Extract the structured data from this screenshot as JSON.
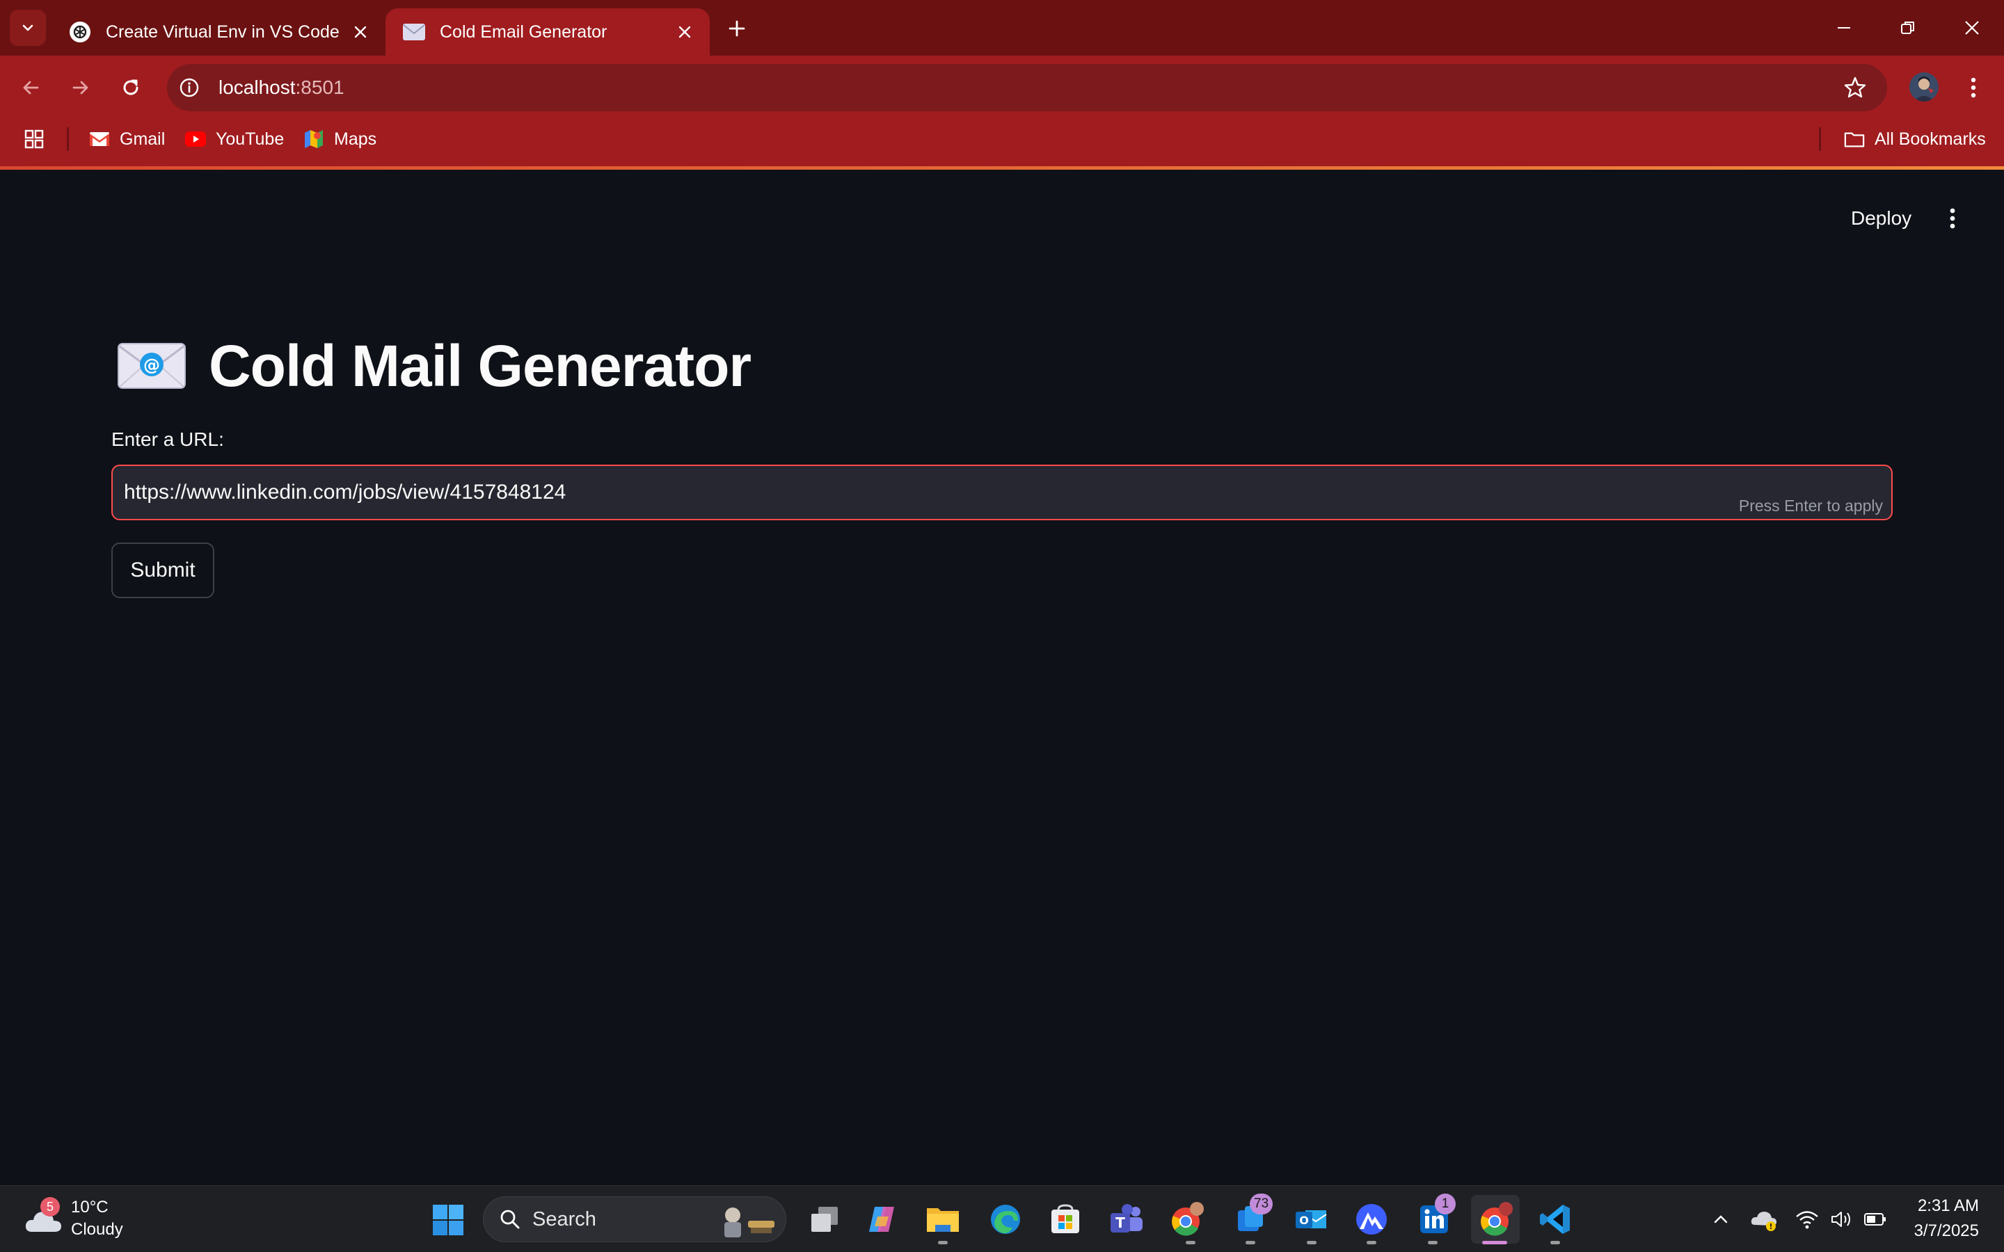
{
  "browser": {
    "tabs": [
      {
        "title": "Create Virtual Env in VS Code",
        "active": false
      },
      {
        "title": "Cold Email Generator",
        "active": true
      }
    ],
    "address": {
      "host": "localhost",
      "port": ":8501"
    },
    "bookmarks": [
      {
        "label": "Gmail",
        "icon": "gmail-icon"
      },
      {
        "label": "YouTube",
        "icon": "youtube-icon"
      },
      {
        "label": "Maps",
        "icon": "maps-icon"
      }
    ],
    "all_bookmarks_label": "All Bookmarks",
    "colors": {
      "frame": "#6b1111",
      "toolbar": "#a01c1f",
      "accent_line": "#f08a3c"
    }
  },
  "app": {
    "deploy_label": "Deploy",
    "title": "Cold Mail Generator",
    "title_emoji": "envelope-with-at-sign",
    "url_label": "Enter a URL:",
    "url_value": "https://www.linkedin.com/jobs/view/4157848124",
    "input_hint": "Press Enter to apply",
    "submit_label": "Submit",
    "colors": {
      "background": "#0e1117",
      "input_bg": "#262730",
      "focus_border": "#ff4b4b",
      "text": "#fafafa"
    }
  },
  "taskbar": {
    "weather": {
      "badge": "5",
      "temp": "10°C",
      "condition": "Cloudy"
    },
    "search_label": "Search",
    "badges": {
      "mail": "73",
      "linkedin": "1"
    },
    "clock": {
      "time": "2:31 AM",
      "date": "3/7/2025"
    }
  }
}
